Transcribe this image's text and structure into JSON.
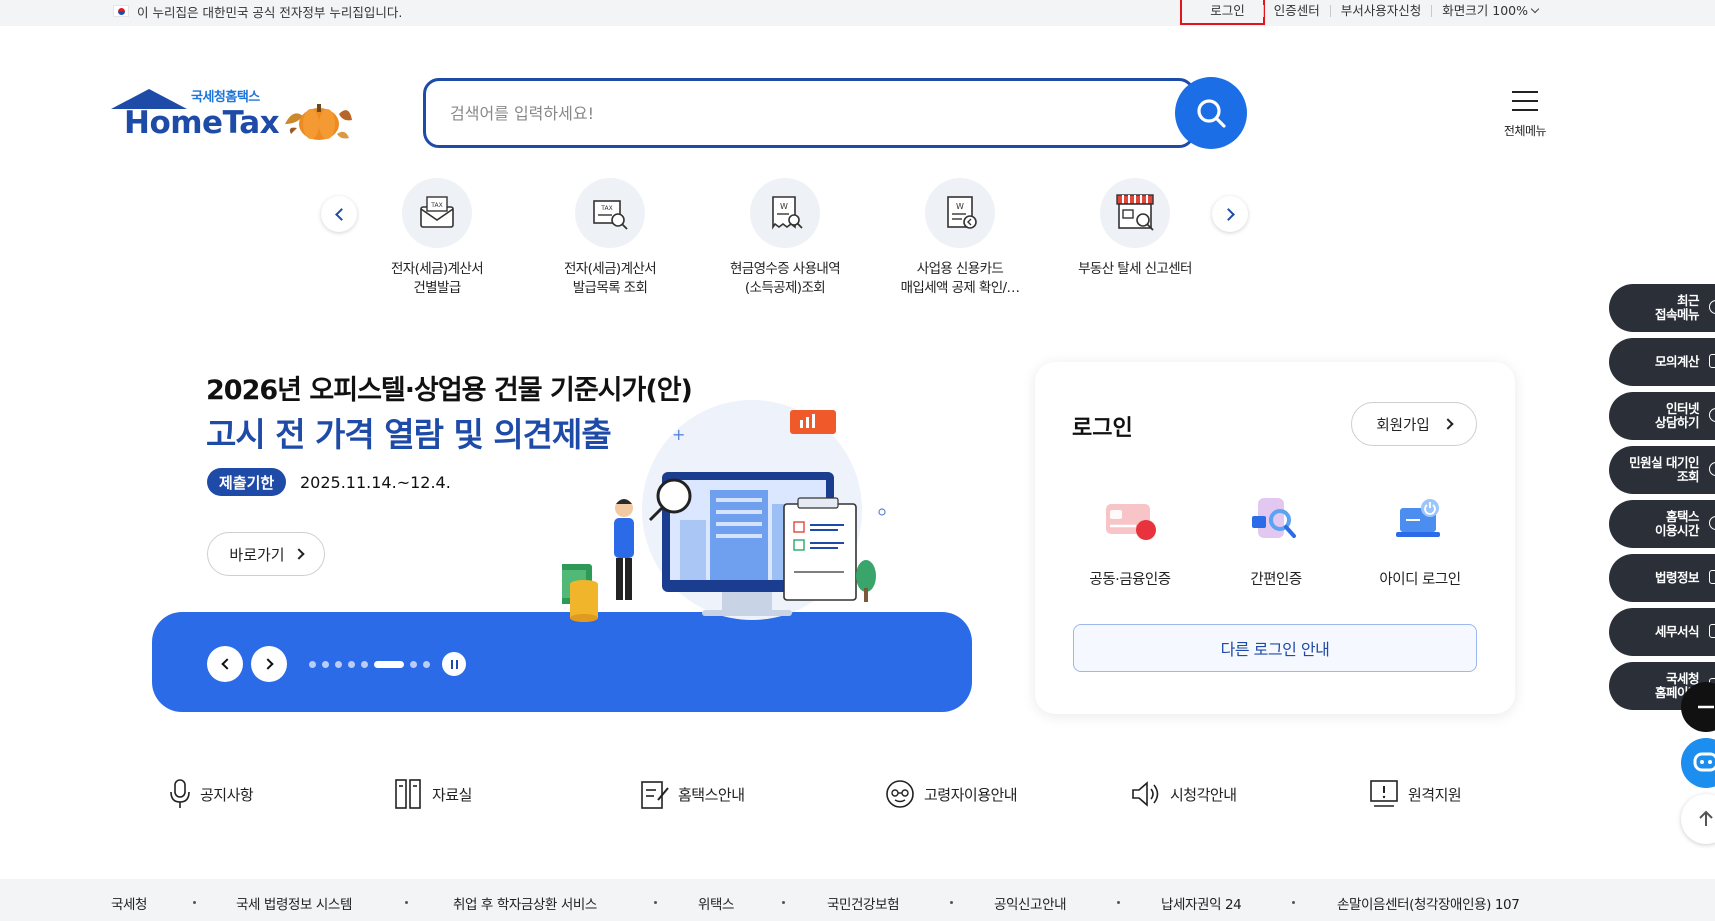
{
  "topbar": {
    "notice": "이 누리집은 대한민국 공식 전자정부 누리집입니다.",
    "links": [
      "로그인",
      "인증센터",
      "부서사용자신청",
      "화면크기"
    ],
    "zoom": "100%"
  },
  "header": {
    "logo_sub": "국세청홈택스",
    "logo_main": "HomeTax",
    "search_placeholder": "검색어를 입력하세요!",
    "allmenu_label": "전체메뉴"
  },
  "quick": [
    {
      "label1": "전자(세금)계산서",
      "label2": "건별발급"
    },
    {
      "label1": "전자(세금)계산서",
      "label2": "발급목록 조회"
    },
    {
      "label1": "현금영수증 사용내역",
      "label2": "(소득공제)조회"
    },
    {
      "label1": "사업용 신용카드",
      "label2": "매입세액 공제 확인/…"
    },
    {
      "label1": "부동산 탈세 신고센터",
      "label2": ""
    }
  ],
  "banner": {
    "title1": "2026년 오피스텔·상업용 건물 기준시가(안)",
    "title2": "고시 전 가격 열람 및 의견제출",
    "tag": "제출기한",
    "date": "2025.11.14.~12.4.",
    "go_label": "바로가기",
    "slide_count": 8,
    "active_slide": 6
  },
  "login_card": {
    "title": "로그인",
    "join_label": "회원가입",
    "methods": [
      "공동·금융인증",
      "간편인증",
      "아이디 로그인"
    ],
    "other_label": "다른 로그인 안내"
  },
  "right_menu": [
    {
      "l1": "최근",
      "l2": "접속메뉴"
    },
    {
      "l1": "모의계산",
      "l2": ""
    },
    {
      "l1": "인터넷",
      "l2": "상담하기"
    },
    {
      "l1": "민원실 대기인",
      "l2": "조회"
    },
    {
      "l1": "홈택스",
      "l2": "이용시간"
    },
    {
      "l1": "법령정보",
      "l2": ""
    },
    {
      "l1": "세무서식",
      "l2": ""
    },
    {
      "l1": "국세청",
      "l2": "홈페이지"
    }
  ],
  "shortcuts": [
    "공지사항",
    "자료실",
    "홈택스안내",
    "고령자이용안내",
    "시청각안내",
    "원격지원"
  ],
  "footer_links": [
    "국세청",
    "국세 법령정보 시스템",
    "취업 후 학자금상환 서비스",
    "위택스",
    "국민건강보험",
    "공익신고안내",
    "납세자권익 24",
    "손말이음센터(청각장애인용) 107"
  ],
  "colors": {
    "brand": "#1f4ba8",
    "accent": "#1b6ee6",
    "highlight": "#e1141c",
    "dark": "#2b3038"
  }
}
